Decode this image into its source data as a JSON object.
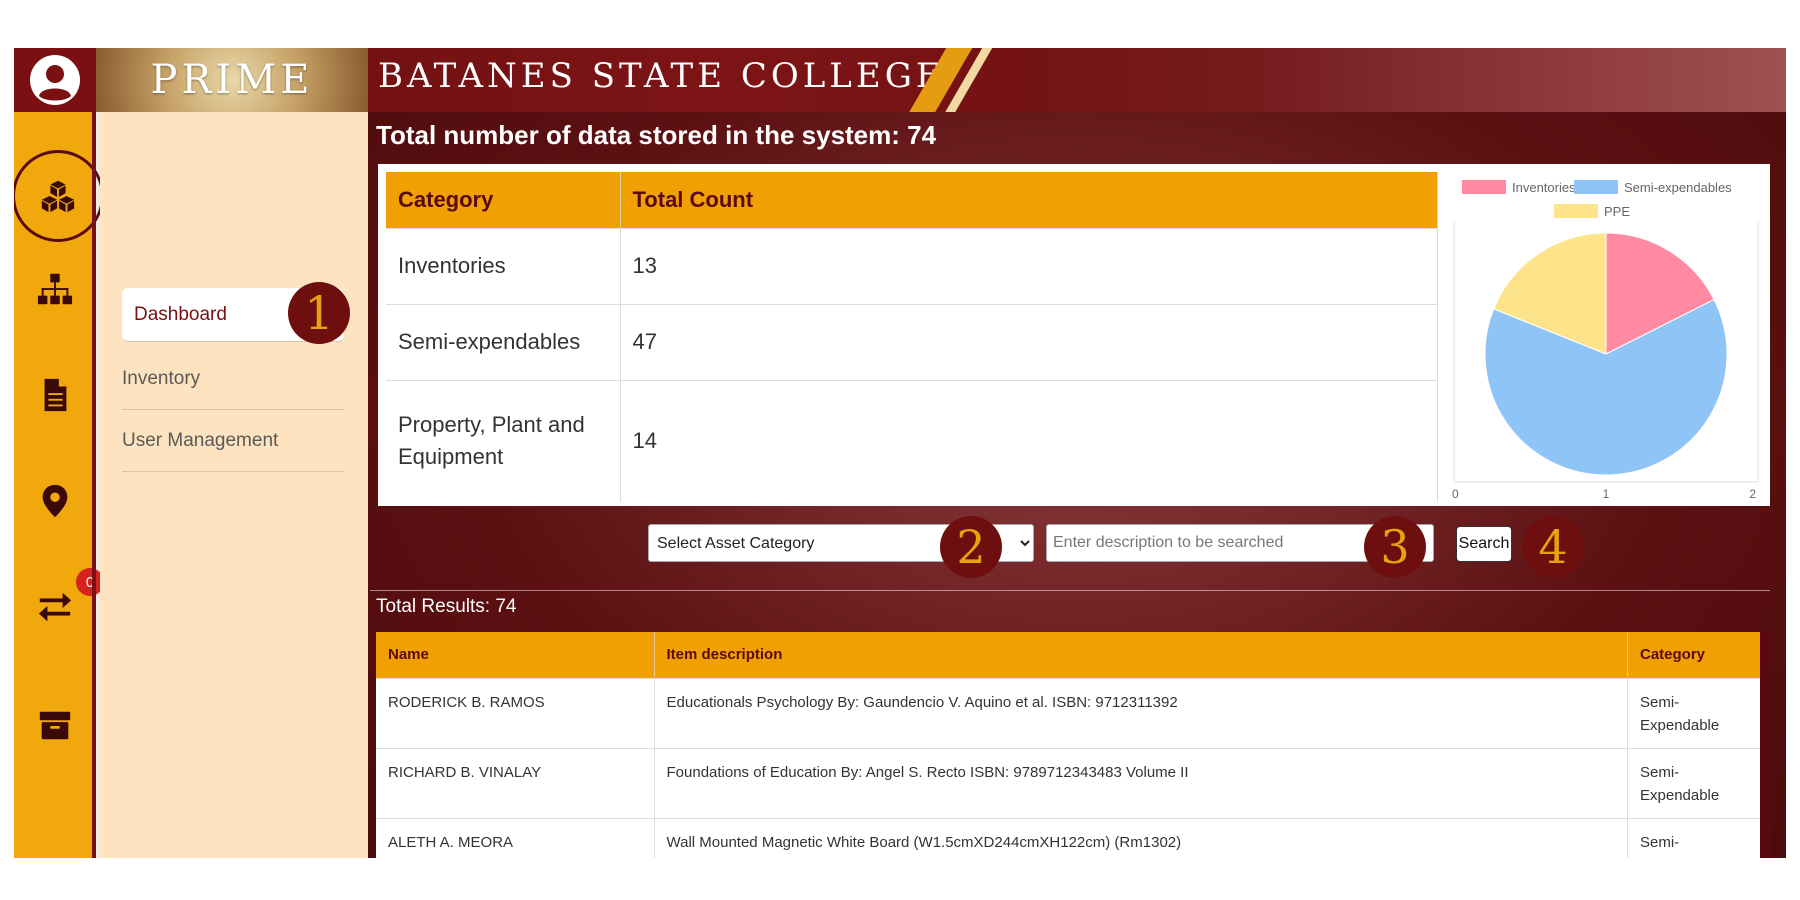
{
  "header": {
    "logo_text": "PRIME",
    "college_name": "BATANES STATE COLLEGE"
  },
  "icon_rail": {
    "transfer_badge": "0"
  },
  "sidenav": {
    "items": [
      {
        "label": "Dashboard",
        "active": true
      },
      {
        "label": "Inventory",
        "active": false
      },
      {
        "label": "User Management",
        "active": false
      }
    ]
  },
  "step_badges": [
    "1",
    "2",
    "3",
    "4"
  ],
  "summary": {
    "title": "Total number of data stored in the system: 74",
    "columns": [
      "Category",
      "Total Count"
    ],
    "rows": [
      {
        "category": "Inventories",
        "count": "13"
      },
      {
        "category": "Semi-expendables",
        "count": "47"
      },
      {
        "category": "Property, Plant and Equipment",
        "count": "14"
      }
    ]
  },
  "chart_data": {
    "type": "pie",
    "labels": [
      "Inventories",
      "Semi-expendables",
      "PPE"
    ],
    "values": [
      13,
      47,
      14
    ],
    "colors": [
      "#ff8aa1",
      "#8ec4f6",
      "#fde48a"
    ],
    "x_ticks": [
      "0",
      "1",
      "2"
    ],
    "legend_position": "top"
  },
  "search": {
    "category_select": "Select Asset Category",
    "placeholder": "Enter description to be searched",
    "button_label": "Search"
  },
  "results": {
    "count_label": "Total Results: 74",
    "columns": [
      "Name",
      "Item description",
      "Category"
    ],
    "rows": [
      {
        "name": "RODERICK B. RAMOS",
        "description": "Educationals Psychology By: Gaundencio V. Aquino et al. ISBN: 9712311392",
        "category": "Semi-Expendable"
      },
      {
        "name": "RICHARD B. VINALAY",
        "description": "Foundations of Education By: Angel S. Recto ISBN: 9789712343483 Volume II",
        "category": "Semi-Expendable"
      },
      {
        "name": "ALETH A. MEORA",
        "description": "Wall Mounted Magnetic White Board (W1.5cmXD244cmXH122cm) (Rm1302)",
        "category": "Semi-Expendable"
      }
    ]
  }
}
